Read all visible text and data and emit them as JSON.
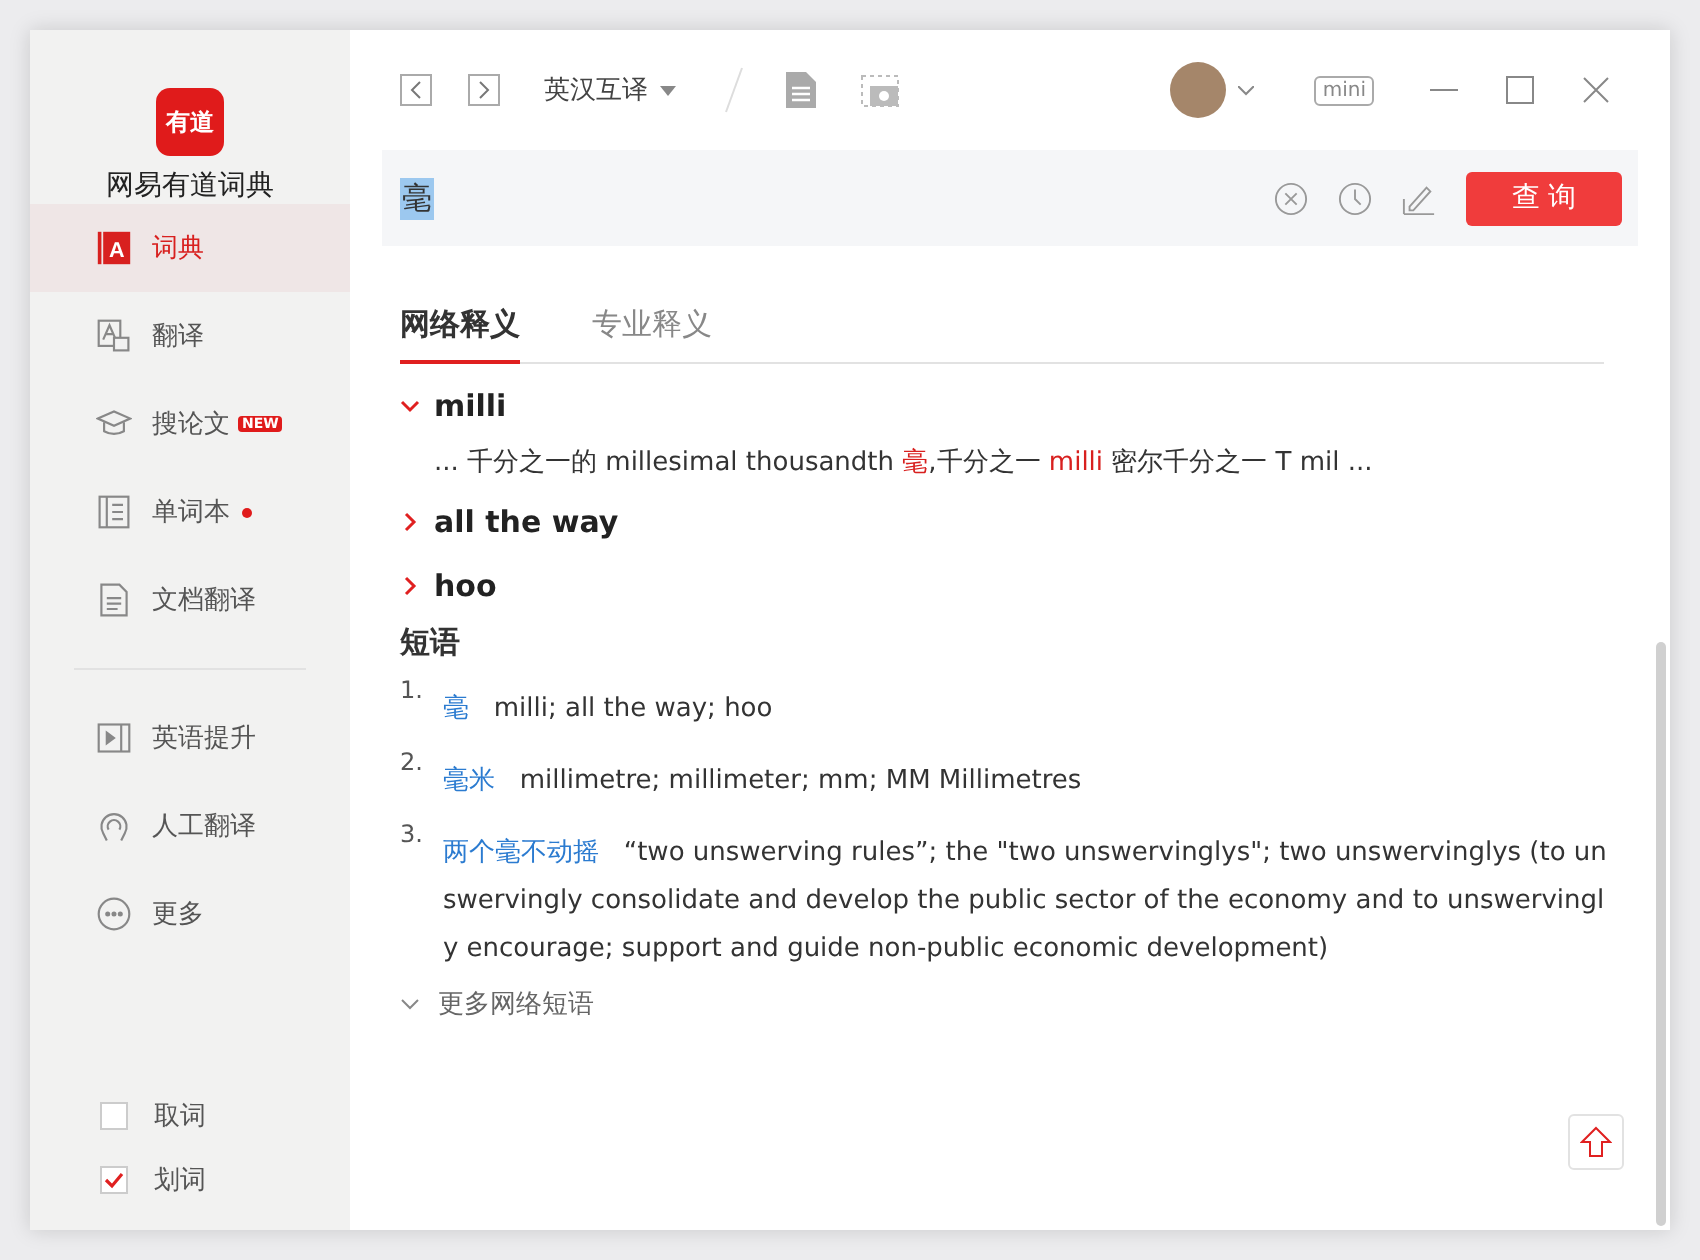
{
  "app": {
    "name": "网易有道词典",
    "logo_text": "有道"
  },
  "toolbar": {
    "mode": "英汉互译",
    "mini": "mini"
  },
  "search": {
    "value": "毫",
    "button": "查 询"
  },
  "sidebar": {
    "items": [
      {
        "label": "词典",
        "kind": "dict",
        "selected": true,
        "icon_letter": "A"
      },
      {
        "label": "翻译",
        "kind": "translate",
        "selected": false
      },
      {
        "label": "搜论文",
        "kind": "paper",
        "selected": false,
        "badge": "NEW"
      },
      {
        "label": "单词本",
        "kind": "wordbook",
        "selected": false,
        "dot": true
      },
      {
        "label": "文档翻译",
        "kind": "doc",
        "selected": false
      }
    ],
    "items2": [
      {
        "label": "英语提升",
        "kind": "video",
        "selected": false
      },
      {
        "label": "人工翻译",
        "kind": "human",
        "selected": false
      },
      {
        "label": "更多",
        "kind": "more",
        "selected": false
      }
    ],
    "checkboxes": [
      {
        "label": "取词",
        "checked": false
      },
      {
        "label": "划词",
        "checked": true
      }
    ]
  },
  "tabs": [
    {
      "label": "网络释义",
      "selected": true
    },
    {
      "label": "专业释义",
      "selected": false
    }
  ],
  "entries": [
    {
      "word": "milli",
      "expanded": true,
      "definition": [
        {
          "text": "... 千分之一的 millesimal thousandth ",
          "highlight": false
        },
        {
          "text": "毫",
          "highlight": true
        },
        {
          "text": ",千分之一 ",
          "highlight": false
        },
        {
          "text": "milli",
          "highlight": true
        },
        {
          "text": " 密尔千分之一 T mil ...",
          "highlight": false
        }
      ]
    },
    {
      "word": "all the way",
      "expanded": false
    },
    {
      "word": "hoo",
      "expanded": false
    }
  ],
  "phrases": {
    "heading": "短语",
    "items": [
      {
        "number": "1.",
        "term": "毫",
        "meaning": "milli;  all the way;  hoo"
      },
      {
        "number": "2.",
        "term": "毫米",
        "meaning": "millimetre;  millimeter;  mm;  MM Millimetres"
      },
      {
        "number": "3.",
        "term": "两个毫不动摇",
        "meaning": "“two unswerving rules”;  the \"two unswervinglys\";  two unswervinglys (to unswervingly consolidate and develop the public sector of the economy and to unswervingly encourage; support and guide non-public economic development)"
      }
    ],
    "more": "更多网络短语"
  }
}
